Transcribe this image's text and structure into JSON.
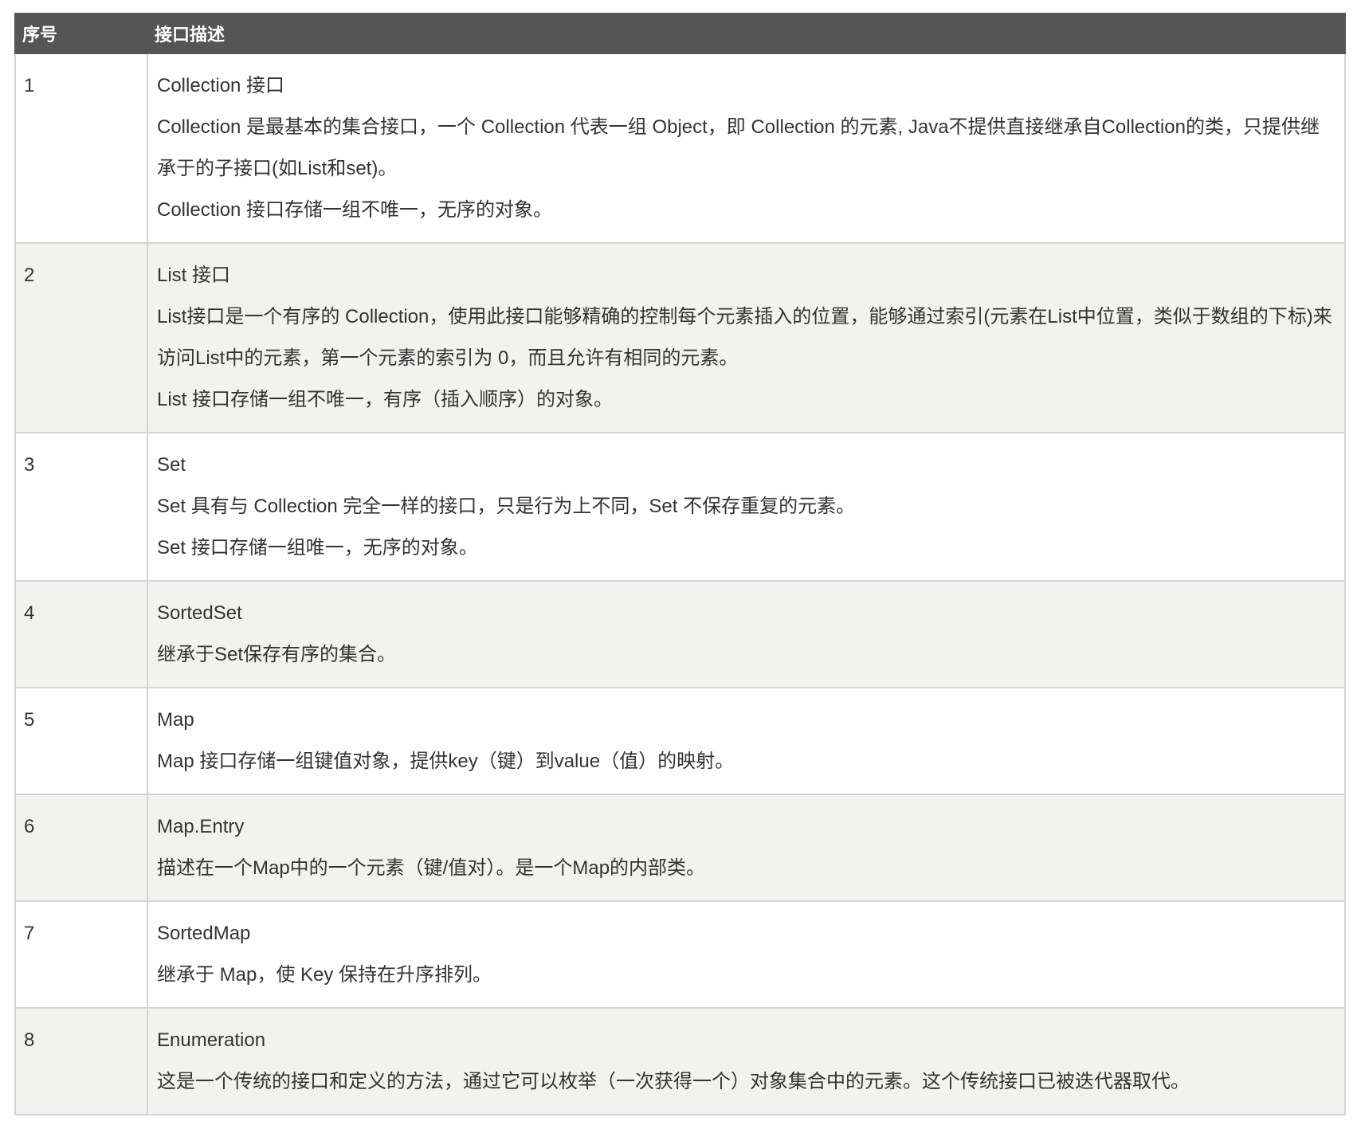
{
  "table": {
    "headers": {
      "number": "序号",
      "description": "接口描述"
    },
    "rows": [
      {
        "number": "1",
        "title": "Collection 接口",
        "lines": [
          "Collection 是最基本的集合接口，一个 Collection 代表一组 Object，即 Collection 的元素, Java不提供直接继承自Collection的类，只提供继承于的子接口(如List和set)。",
          "Collection 接口存储一组不唯一，无序的对象。"
        ]
      },
      {
        "number": "2",
        "title": "List 接口",
        "lines": [
          "List接口是一个有序的 Collection，使用此接口能够精确的控制每个元素插入的位置，能够通过索引(元素在List中位置，类似于数组的下标)来访问List中的元素，第一个元素的索引为 0，而且允许有相同的元素。",
          "List 接口存储一组不唯一，有序（插入顺序）的对象。"
        ]
      },
      {
        "number": "3",
        "title": "Set",
        "lines": [
          "Set 具有与 Collection 完全一样的接口，只是行为上不同，Set 不保存重复的元素。",
          "Set 接口存储一组唯一，无序的对象。"
        ]
      },
      {
        "number": "4",
        "title": "SortedSet",
        "lines": [
          "继承于Set保存有序的集合。"
        ]
      },
      {
        "number": "5",
        "title": "Map",
        "lines": [
          "Map 接口存储一组键值对象，提供key（键）到value（值）的映射。"
        ]
      },
      {
        "number": "6",
        "title": "Map.Entry",
        "lines": [
          "描述在一个Map中的一个元素（键/值对）。是一个Map的内部类。"
        ]
      },
      {
        "number": "7",
        "title": "SortedMap",
        "lines": [
          "继承于 Map，使 Key 保持在升序排列。"
        ]
      },
      {
        "number": "8",
        "title": "Enumeration",
        "lines": [
          "这是一个传统的接口和定义的方法，通过它可以枚举（一次获得一个）对象集合中的元素。这个传统接口已被迭代器取代。"
        ]
      }
    ]
  }
}
